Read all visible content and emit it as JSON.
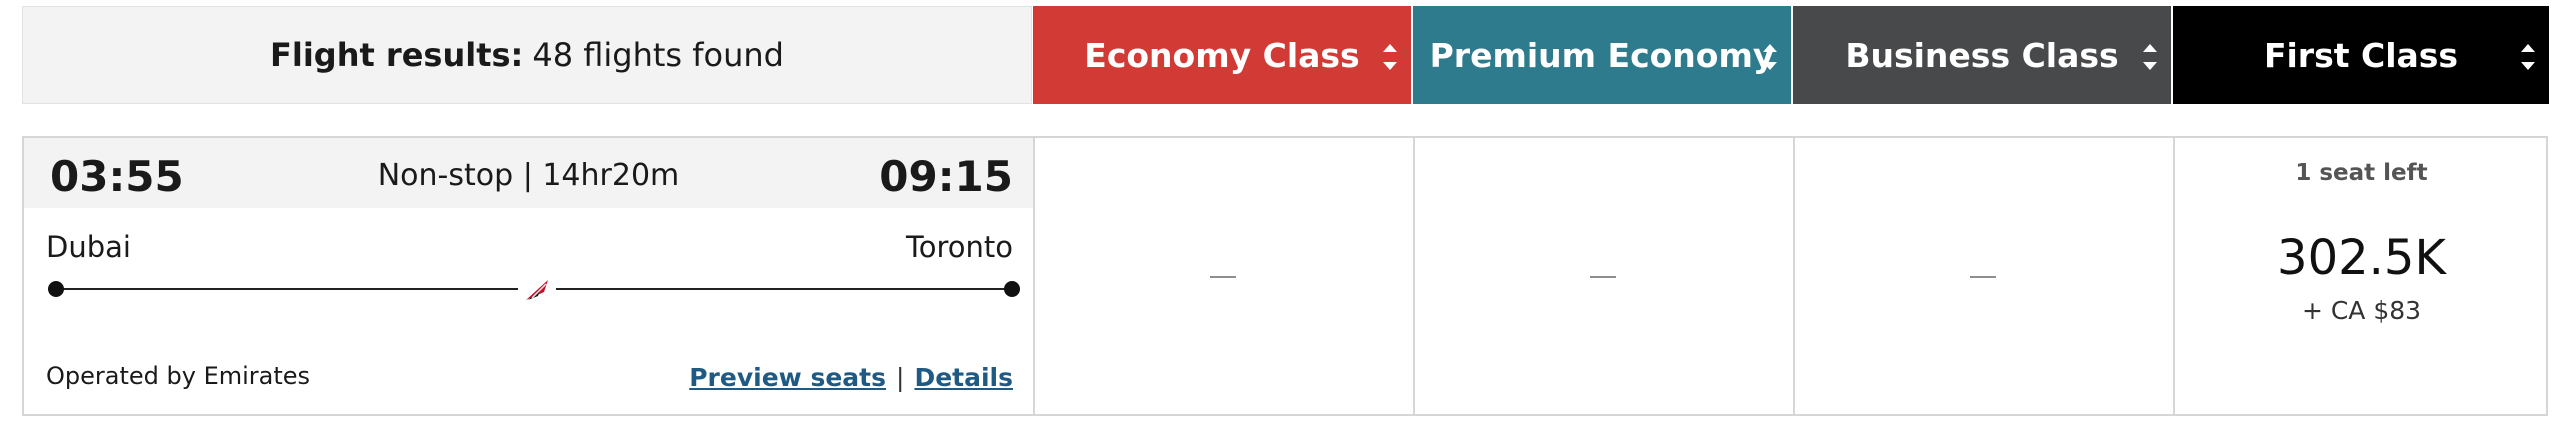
{
  "header": {
    "results_label": "Flight results:",
    "results_count": "48 flights found",
    "cabins": [
      {
        "label": "Economy Class",
        "color": "#d23b35"
      },
      {
        "label": "Premium Economy",
        "color": "#2f7b8e"
      },
      {
        "label": "Business Class",
        "color": "#47494b"
      },
      {
        "label": "First Class",
        "color": "#000000"
      }
    ]
  },
  "flight": {
    "departure_time": "03:55",
    "arrival_time": "09:15",
    "stops_duration": "Non-stop | 14hr20m",
    "origin": "Dubai",
    "destination": "Toronto",
    "operated_by": "Operated by Emirates",
    "preview_seats_label": "Preview seats",
    "separator": "|",
    "details_label": "Details",
    "airline_icon": "emirates-tail-icon"
  },
  "fares": {
    "economy": {
      "value": "—"
    },
    "premium_economy": {
      "value": "—"
    },
    "business": {
      "value": "—"
    },
    "first": {
      "seats_left": "1 seat left",
      "points": "302.5K",
      "fee": "+ CA $83"
    }
  }
}
